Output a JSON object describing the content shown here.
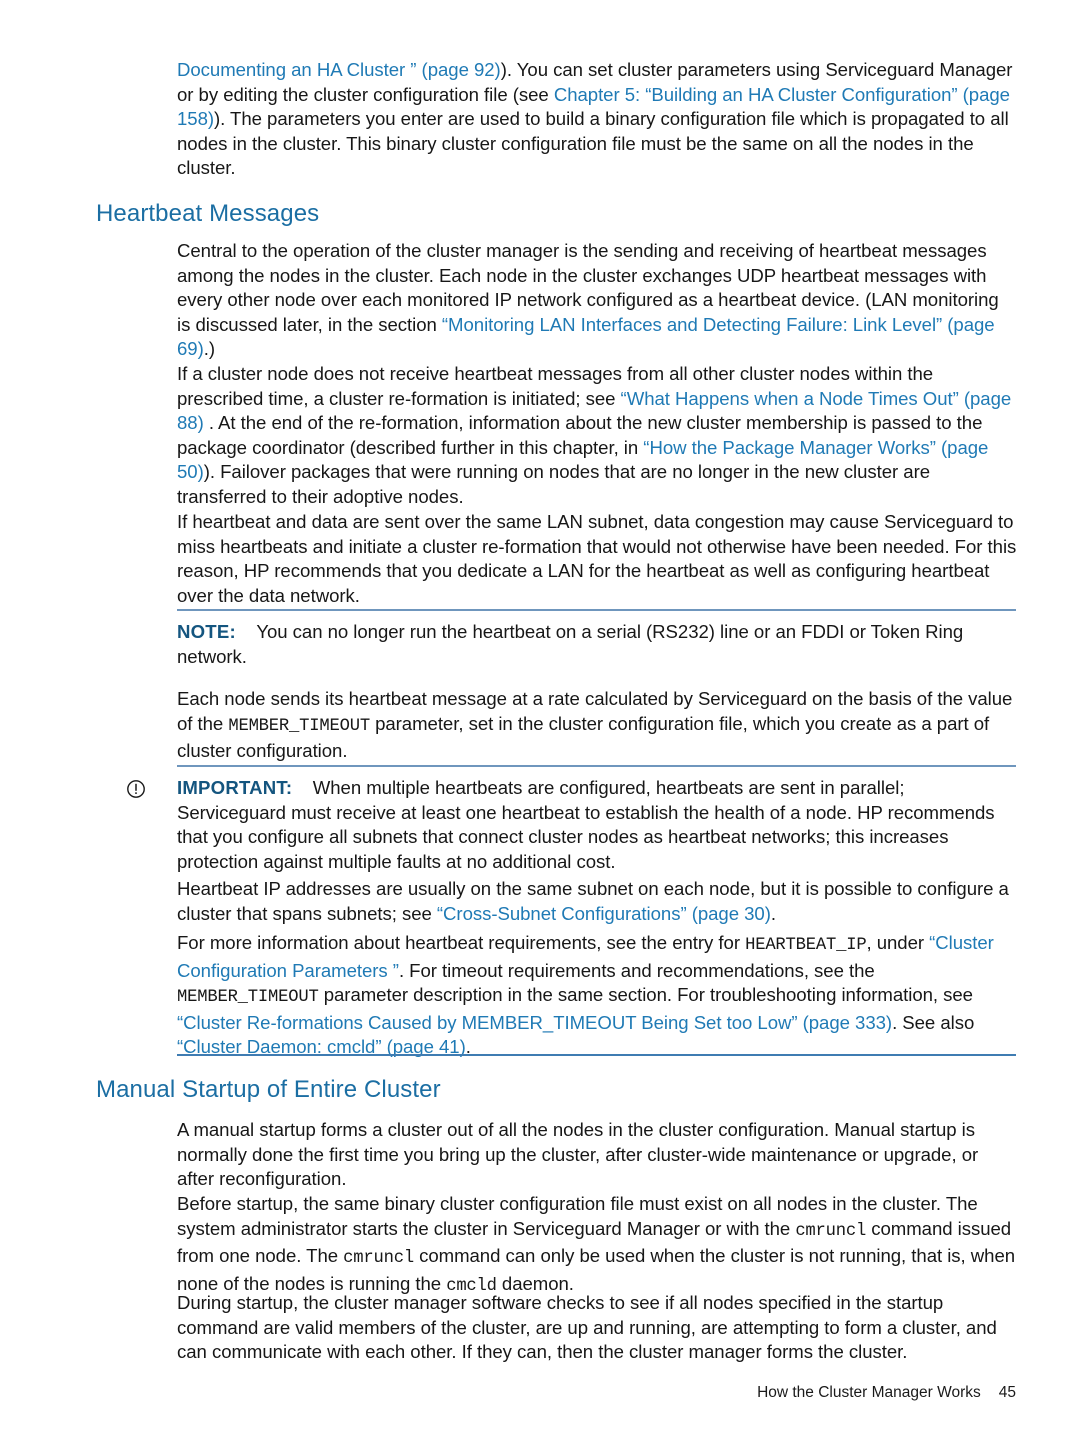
{
  "document": {
    "page_number": "45",
    "footer_title": "How the Cluster Manager Works"
  },
  "content": {
    "intro_paragraph": {
      "link_1": "Documenting an HA Cluster ” (page 92)",
      "text_1": "). You can set cluster parameters using Serviceguard Manager or by editing the cluster configuration file (see ",
      "link_2": "Chapter 5: “Building an HA Cluster Configuration” (page 158)",
      "text_2": "). The parameters you enter are used to build a binary configuration file which is propagated to all nodes in the cluster. This binary cluster configuration file must be the same on all the nodes in the cluster."
    },
    "heading_heartbeat": "Heartbeat Messages",
    "para_central": {
      "text_1": "Central to the operation of the cluster manager is the sending and receiving of heartbeat messages among the nodes in the cluster. Each node in the cluster exchanges UDP heartbeat messages with every other node over each monitored IP network configured as a heartbeat device. (LAN monitoring is discussed later, in the section ",
      "link_1": "“Monitoring LAN Interfaces and Detecting Failure: Link Level” (page 69)",
      "text_2": ".)"
    },
    "para_reformation": {
      "text_1": "If a cluster node does not receive heartbeat messages from all other cluster nodes within the prescribed time, a cluster re-formation is initiated; see ",
      "link_1": "“What Happens when a Node Times Out” (page 88)",
      "text_2": " . At the end of the re-formation, information about the new cluster membership is passed to the package coordinator  (described further in this chapter, in ",
      "link_2": "“How the Package Manager Works” (page 50)",
      "text_3": "). Failover packages that were running on nodes that are no longer in the new cluster are transferred to their adoptive nodes."
    },
    "para_congestion": "If heartbeat and data are sent over the same LAN subnet, data congestion may cause Serviceguard to miss heartbeats and initiate a cluster re-formation that would not otherwise have been needed. For this reason, HP recommends that you dedicate a LAN for the heartbeat as well as configuring heartbeat over the data network.",
    "note": {
      "label": "NOTE:",
      "text": "You can no longer run the heartbeat on a serial (RS232) line or an FDDI or Token Ring network."
    },
    "para_rate": {
      "text_1": "Each node sends its heartbeat message at a rate calculated by Serviceguard on the basis of the value of the ",
      "code_1": "MEMBER_TIMEOUT",
      "text_2": " parameter, set in the cluster configuration file, which you create as a part of cluster configuration."
    },
    "important": {
      "icon": "exclamation-circle-icon",
      "label": "IMPORTANT:",
      "text": "When multiple heartbeats are configured, heartbeats are sent in parallel; Serviceguard must receive at least one heartbeat to establish the health of a node. HP recommends that you configure all subnets that connect cluster nodes as heartbeat networks; this increases protection against multiple faults at no additional cost."
    },
    "para_ip_addresses": {
      "text_1": "Heartbeat IP addresses are usually on the same subnet on each node, but it is possible to configure a cluster that spans subnets; see ",
      "link_1": "“Cross-Subnet Configurations” (page 30)",
      "text_2": "."
    },
    "para_more_info": {
      "text_1": "For more information about heartbeat requirements, see the entry for ",
      "code_1": "HEARTBEAT_IP",
      "text_2": ", under ",
      "link_1": "“Cluster Configuration Parameters ”",
      "text_3": ". For timeout requirements and recommendations, see the ",
      "code_2": "MEMBER_TIMEOUT",
      "text_4": " parameter description in the same section. For troubleshooting information, see ",
      "link_2": "“Cluster Re-formations Caused by MEMBER_TIMEOUT Being Set too Low” (page 333)",
      "text_5": ". See also ",
      "link_3": "“Cluster Daemon: cmcld” (page 41)",
      "text_6": "."
    },
    "heading_manual_startup": "Manual Startup of Entire Cluster",
    "para_manual": "A manual startup forms a cluster out of all the nodes in the cluster configuration. Manual startup is normally done the first time you bring up the cluster, after cluster-wide maintenance or upgrade, or after reconfiguration.",
    "para_before_startup": {
      "text_1": "Before startup, the same binary cluster configuration file must exist on all nodes in the cluster. The system administrator starts the cluster in Serviceguard Manager or with the ",
      "code_1": "cmruncl",
      "text_2": " command issued from one node. The ",
      "code_2": "cmruncl",
      "text_3": " command can only be used when the cluster is not running, that is, when none of the nodes is running the ",
      "code_3": "cmcld",
      "text_4": " daemon."
    },
    "para_during_startup": "During startup, the cluster manager software checks to see if all nodes specified in the startup command are valid members of the cluster, are up and running, are attempting to form a cluster, and can communicate with each other. If they can, then the cluster manager forms the cluster."
  },
  "colors": {
    "link": "#1f7ab5",
    "heading": "#1b6ea3",
    "admonition_label": "#14557f",
    "rule": "#6f96bd",
    "body_text": "#171717"
  }
}
